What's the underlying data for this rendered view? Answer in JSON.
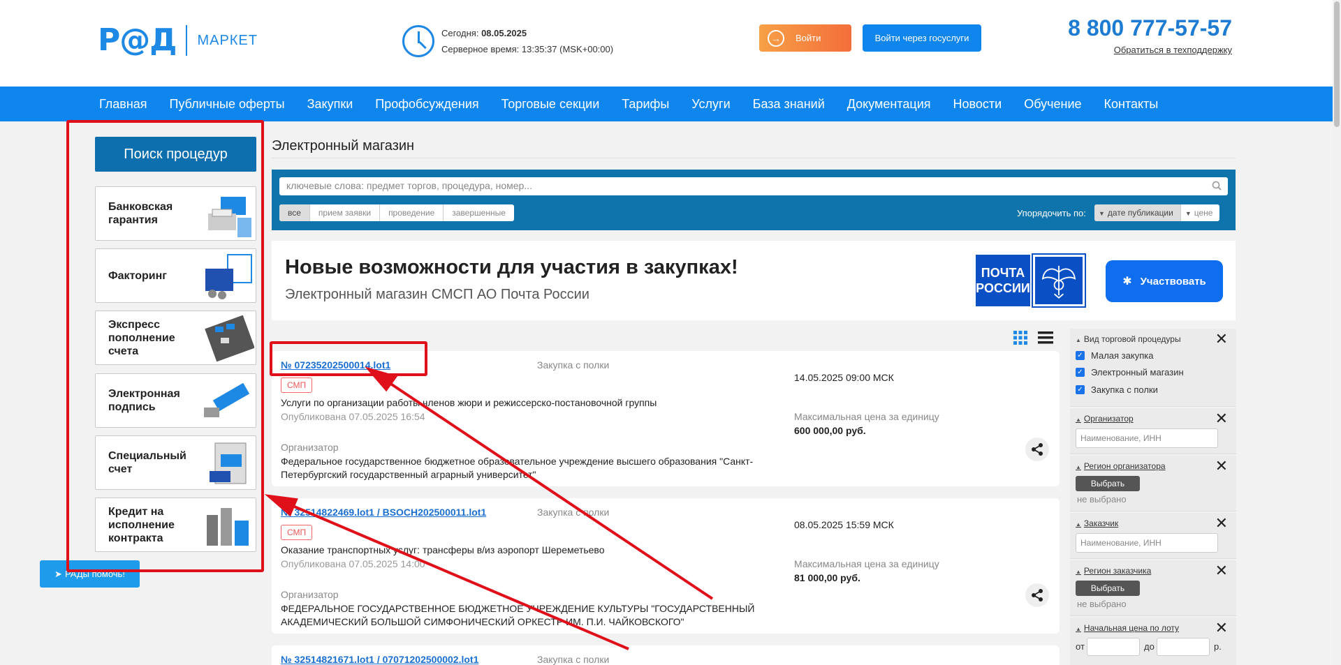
{
  "header": {
    "logo_mark": "Р@Д",
    "logo_text": "МАРКЕТ",
    "today_label": "Сегодня:",
    "today_value": "08.05.2025",
    "server_label": "Серверное время:",
    "server_value": "13:35:37 (MSK+00:00)",
    "login_label": "Войти",
    "gosuslugi_label": "Войти через госуслуги",
    "phone": "8 800 777-57-57",
    "support_label": "Обратиться в техподдержку"
  },
  "nav": [
    "Главная",
    "Публичные оферты",
    "Закупки",
    "Профобсуждения",
    "Торговые секции",
    "Тарифы",
    "Услуги",
    "База знаний",
    "Документация",
    "Новости",
    "Обучение",
    "Контакты"
  ],
  "sidebar": {
    "search_label": "Поиск процедур",
    "promos": [
      "Банковская гарантия",
      "Факторинг",
      "Экспресс пополнение счета",
      "Электронная подпись",
      "Специальный счет",
      "Кредит на исполнение контракта"
    ],
    "help_label": "РАДы помочь!"
  },
  "content": {
    "section_title": "Электронный магазин",
    "search_placeholder": "ключевые слова: предмет торгов, процедура, номер...",
    "filters": [
      "все",
      "прием заявки",
      "проведение",
      "завершенные"
    ],
    "active_filter": "все",
    "sort_label": "Упорядочить по:",
    "sort_options": [
      "дате публикации",
      "цене"
    ],
    "banner": {
      "headline": "Новые возможности для участия в закупках!",
      "subline": "Электронный магазин СМСП АО Почта России",
      "pochta_logo": "ПОЧТА РОССИИ",
      "participate_label": "Участвовать"
    }
  },
  "lots": [
    {
      "number": "№ 07235202500014.lot1",
      "type": "Закупка с полки",
      "badge": "СМП",
      "description": "Услуги по организации работы членов жюри и режиссерско-постановочной группы",
      "published": "Опубликована 07.05.2025 16:54",
      "organizer_label": "Организатор",
      "organizer": "Федеральное государственное бюджетное образовательное учреждение высшего образования \"Санкт-Петербургский государственный аграрный университет\"",
      "date": "14.05.2025 09:00 МСК",
      "price_label": "Максимальная цена за единицу",
      "price": "600 000,00 руб."
    },
    {
      "number": "№ 32514822469.lot1 / BSOCH202500011.lot1",
      "type": "Закупка с полки",
      "badge": "СМП",
      "description": "Оказание транспортных услуг: трансферы в/из аэропорт Шереметьево",
      "published": "Опубликована 07.05.2025 14:00",
      "organizer_label": "Организатор",
      "organizer": "ФЕДЕРАЛЬНОЕ ГОСУДАРСТВЕННОЕ БЮДЖЕТНОЕ УЧРЕЖДЕНИЕ КУЛЬТУРЫ \"ГОСУДАРСТВЕННЫЙ АКАДЕМИЧЕСКИЙ БОЛЬШОЙ СИМФОНИЧЕСКИЙ ОРКЕСТР ИМ. П.И. ЧАЙКОВСКОГО\"",
      "date": "08.05.2025 15:59 МСК",
      "price_label": "Максимальная цена за единицу",
      "price": "81 000,00 руб."
    },
    {
      "number": "№ 32514821671.lot1 / 07071202500002.lot1",
      "type": "Закупка с полки"
    }
  ],
  "filter_panel": {
    "procedure_type_title": "Вид торговой процедуры",
    "procedure_types": [
      "Малая закупка",
      "Электронный магазин",
      "Закупка с полки"
    ],
    "organizer_title": "Организатор",
    "organizer_placeholder": "Наименование, ИНН",
    "organizer_region_title": "Регион организатора",
    "select_label": "Выбрать",
    "not_selected": "не выбрано",
    "customer_title": "Заказчик",
    "customer_placeholder": "Наименование, ИНН",
    "customer_region_title": "Регион заказчика",
    "price_title": "Начальная цена по лоту",
    "from_label": "от",
    "to_label": "до",
    "currency": "р."
  },
  "colors": {
    "brand_blue": "#0f86ee",
    "dark_blue": "#0e74ab",
    "login_orange": "#f46e3b",
    "annotation_red": "#e0101a"
  }
}
